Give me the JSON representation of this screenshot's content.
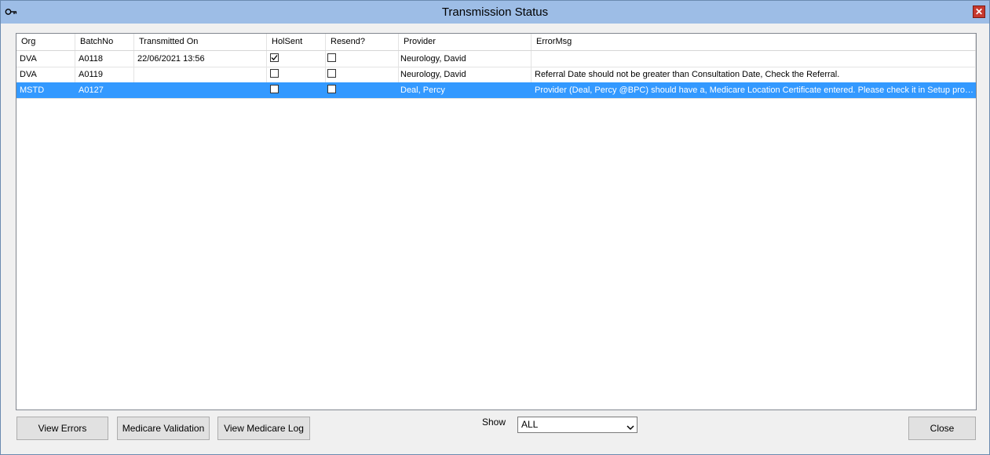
{
  "window": {
    "title": "Transmission Status",
    "close_glyph": "✕",
    "title_icon": "key-icon"
  },
  "grid": {
    "columns": [
      "Org",
      "BatchNo",
      "Transmitted On",
      "HolSent",
      "Resend?",
      "Provider",
      "ErrorMsg"
    ],
    "rows": [
      {
        "org": "DVA",
        "batch": "A0118",
        "transmitted": "22/06/2021 13:56",
        "holsent": true,
        "resend": false,
        "provider": "Neurology, David",
        "error": "",
        "selected": false
      },
      {
        "org": "DVA",
        "batch": "A0119",
        "transmitted": "",
        "holsent": false,
        "resend": false,
        "provider": "Neurology, David",
        "error": "Referral Date should not be greater than Consultation Date, Check the Referral.",
        "selected": false
      },
      {
        "org": "MSTD",
        "batch": "A0127",
        "transmitted": "",
        "holsent": false,
        "resend": false,
        "provider": "Deal, Percy",
        "error": "Provider (Deal, Percy @BPC) should have a, Medicare Location Certificate entered. Please check it in Setup provi...",
        "selected": true
      }
    ]
  },
  "buttons": {
    "view_errors": "View Errors",
    "medicare_validation": "Medicare Validation",
    "view_medicare_log": "View Medicare Log",
    "close": "Close"
  },
  "filter": {
    "label": "Show",
    "selected": "ALL"
  },
  "colors": {
    "selection": "#3399ff",
    "titlebar": "#9dbde6",
    "close_button": "#c7392e"
  }
}
